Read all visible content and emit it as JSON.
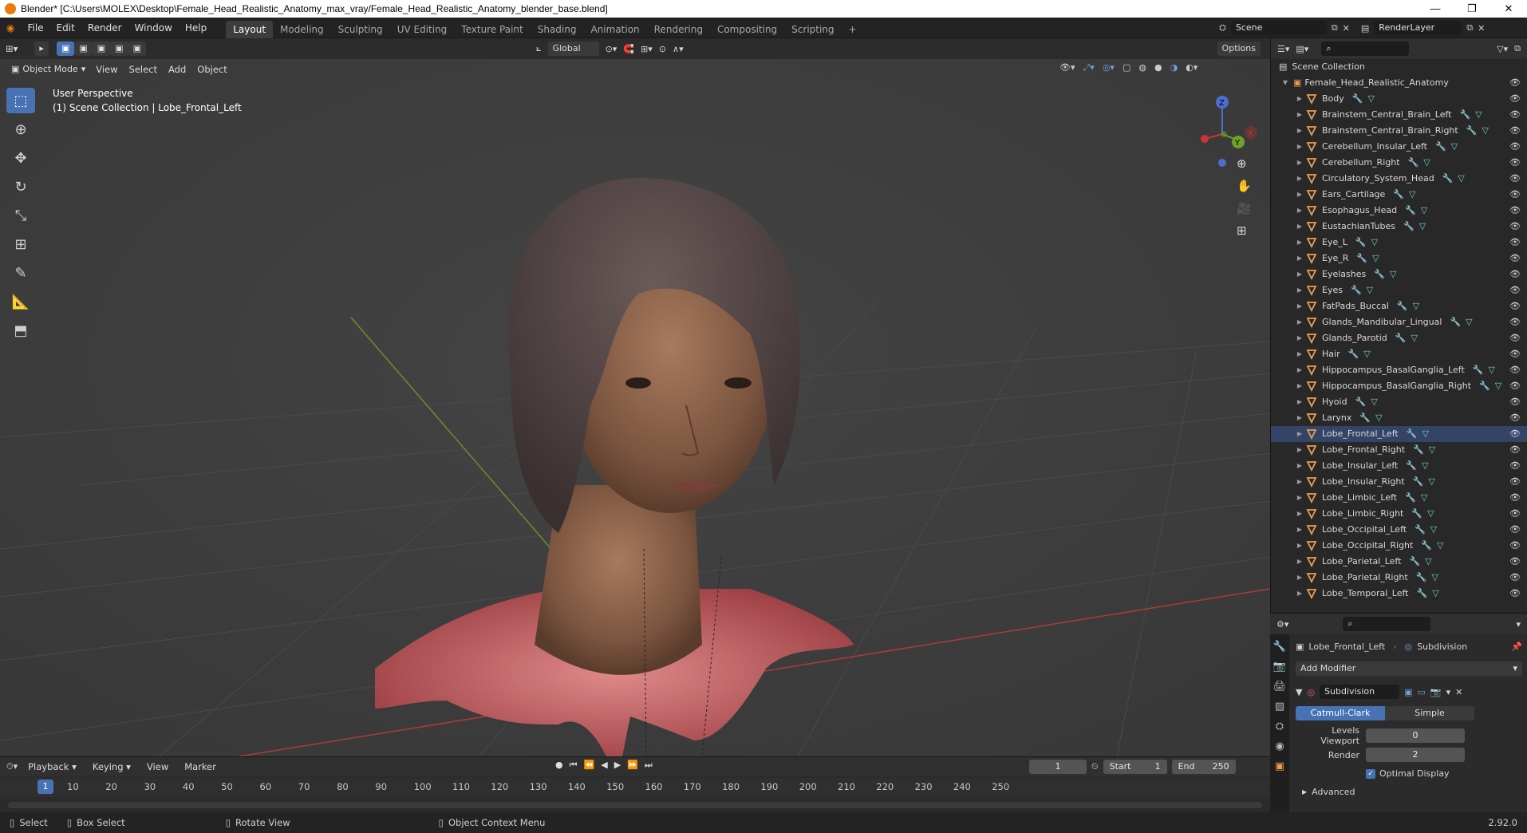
{
  "window": {
    "title": "Blender* [C:\\Users\\MOLEX\\Desktop\\Female_Head_Realistic_Anatomy_max_vray/Female_Head_Realistic_Anatomy_blender_base.blend]",
    "min": "—",
    "max": "❐",
    "close": "✕"
  },
  "menubar": {
    "menus": [
      "File",
      "Edit",
      "Render",
      "Window",
      "Help"
    ],
    "workspaces": [
      "Layout",
      "Modeling",
      "Sculpting",
      "UV Editing",
      "Texture Paint",
      "Shading",
      "Animation",
      "Rendering",
      "Compositing",
      "Scripting"
    ],
    "add_tab": "+",
    "scene": "Scene",
    "render_layer": "RenderLayer"
  },
  "viewport": {
    "orientation": "Global",
    "options": "Options",
    "mode": "Object Mode",
    "menus": [
      "View",
      "Select",
      "Add",
      "Object"
    ],
    "overlay_line1": "User Perspective",
    "overlay_line2": "(1) Scene Collection | Lobe_Frontal_Left",
    "gizmo": {
      "z": "Z",
      "y": "Y",
      "x": "X"
    }
  },
  "outliner": {
    "root": "Scene Collection",
    "collection": "Female_Head_Realistic_Anatomy",
    "selected": "Lobe_Frontal_Left",
    "items": [
      "Body",
      "Brainstem_Central_Brain_Left",
      "Brainstem_Central_Brain_Right",
      "Cerebellum_Insular_Left",
      "Cerebellum_Right",
      "Circulatory_System_Head",
      "Ears_Cartilage",
      "Esophagus_Head",
      "EustachianTubes",
      "Eye_L",
      "Eye_R",
      "Eyelashes",
      "Eyes",
      "FatPads_Buccal",
      "Glands_Mandibular_Lingual",
      "Glands_Parotid",
      "Hair",
      "Hippocampus_BasalGanglia_Left",
      "Hippocampus_BasalGanglia_Right",
      "Hyoid",
      "Larynx",
      "Lobe_Frontal_Left",
      "Lobe_Frontal_Right",
      "Lobe_Insular_Left",
      "Lobe_Insular_Right",
      "Lobe_Limbic_Left",
      "Lobe_Limbic_Right",
      "Lobe_Occipital_Left",
      "Lobe_Occipital_Right",
      "Lobe_Parietal_Left",
      "Lobe_Parietal_Right",
      "Lobe_Temporal_Left"
    ]
  },
  "properties": {
    "object": "Lobe_Frontal_Left",
    "modifier_crumb": "Subdivision",
    "add_modifier": "Add Modifier",
    "modifier_name": "Subdivision",
    "mode_catmull": "Catmull-Clark",
    "mode_simple": "Simple",
    "levels_viewport_label": "Levels Viewport",
    "levels_viewport": "0",
    "render_label": "Render",
    "render_value": "2",
    "optimal_display": "Optimal Display",
    "advanced": "Advanced"
  },
  "timeline": {
    "menus": [
      "Playback",
      "Keying",
      "View",
      "Marker"
    ],
    "current_frame": "1",
    "start_label": "Start",
    "start": "1",
    "end_label": "End",
    "end": "250",
    "ticks": [
      "10",
      "20",
      "30",
      "40",
      "50",
      "60",
      "70",
      "80",
      "90",
      "100",
      "110",
      "120",
      "130",
      "140",
      "150",
      "160",
      "170",
      "180",
      "190",
      "200",
      "210",
      "220",
      "230",
      "240",
      "250"
    ],
    "playhead": "1"
  },
  "statusbar": {
    "select": "Select",
    "box_select": "Box Select",
    "rotate": "Rotate View",
    "context": "Object Context Menu",
    "version": "2.92.0"
  },
  "colors": {
    "accent": "#4772b3",
    "orange": "#e87d0d",
    "grid_x": "#b03a3a",
    "grid_y": "#6a8f2a"
  }
}
